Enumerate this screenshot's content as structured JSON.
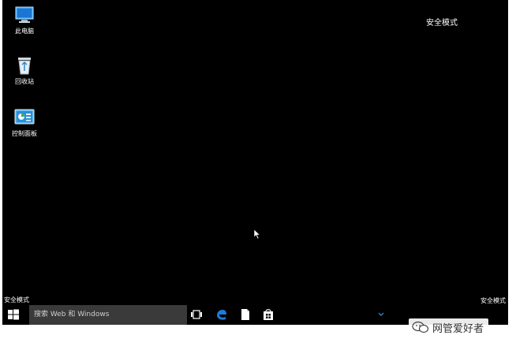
{
  "desktop": {
    "icons": [
      {
        "label": "此电脑",
        "icon": "computer-icon"
      },
      {
        "label": "回收站",
        "icon": "recycle-bin-icon"
      },
      {
        "label": "控制面板",
        "icon": "control-panel-icon"
      }
    ],
    "safe_mode_top_right": "安全模式",
    "safe_mode_bottom_left": "安全模式",
    "safe_mode_bottom_right": "安全模式"
  },
  "taskbar": {
    "start_icon": "windows-logo-icon",
    "search_placeholder": "搜索 Web 和 Windows",
    "pinned": [
      {
        "icon": "task-view-icon"
      },
      {
        "icon": "edge-browser-icon"
      },
      {
        "icon": "file-explorer-icon"
      },
      {
        "icon": "store-icon"
      }
    ]
  },
  "watermark": {
    "text": "网管爱好者",
    "icon": "wechat-icon"
  },
  "colors": {
    "desktop_bg": "#000000",
    "search_bg": "#3a3a3a",
    "edge_blue": "#1e7bd8"
  }
}
